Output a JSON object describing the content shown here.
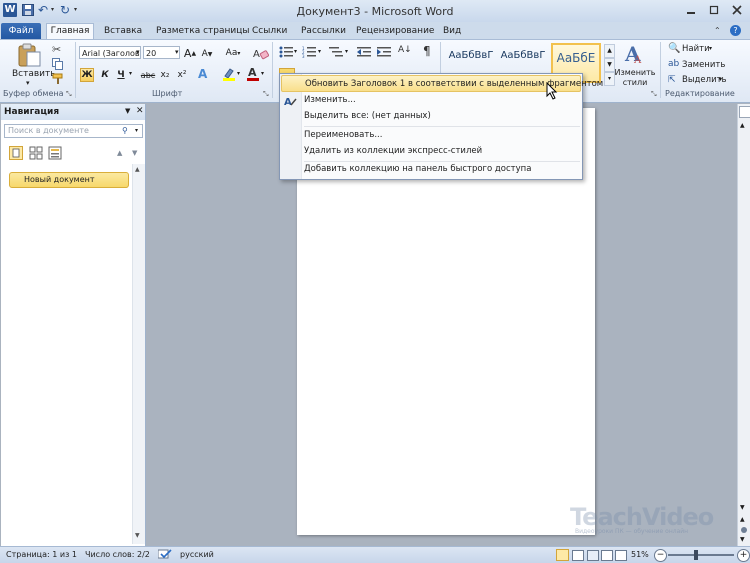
{
  "window": {
    "title": "Документ3  -  Microsoft Word"
  },
  "tabs": [
    {
      "label": "Файл"
    },
    {
      "label": "Главная"
    },
    {
      "label": "Вставка"
    },
    {
      "label": "Разметка страницы"
    },
    {
      "label": "Ссылки"
    },
    {
      "label": "Рассылки"
    },
    {
      "label": "Рецензирование"
    },
    {
      "label": "Вид"
    }
  ],
  "clipboard": {
    "paste_label": "Вставить",
    "group_label": "Буфер обмена"
  },
  "font": {
    "name": "Arial (Заголов",
    "size": "20",
    "group_label": "Шрифт",
    "bold": "Ж",
    "italic": "К",
    "underline": "Ч",
    "grow": "A",
    "shrink": "A",
    "case": "Aa",
    "strike": "abc",
    "sub": "x₂",
    "sup": "x²"
  },
  "styles": {
    "thumbnails": [
      "АаБбВвГ",
      "АаБбВвГ",
      "АаБбЕ"
    ],
    "change_label": "Изменить стили"
  },
  "editing": {
    "find": "Найти",
    "replace": "Заменить",
    "select": "Выделить",
    "group_label": "Редактирование"
  },
  "context_menu": {
    "items": [
      "Обновить Заголовок 1 в соответствии с выделенным фрагментом",
      "Изменить...",
      "Выделить все: (нет данных)",
      "Переименовать...",
      "Удалить из коллекции экспресс-стилей",
      "Добавить коллекцию на панель быстрого доступа"
    ]
  },
  "navigation": {
    "title": "Навигация",
    "search_placeholder": "Поиск в документе",
    "items": [
      "Новый документ"
    ]
  },
  "status": {
    "page": "Страница: 1 из 1",
    "words": "Число слов: 2/2",
    "language": "русский",
    "zoom": "51%"
  },
  "watermark": {
    "text": "TeachVideo",
    "subtitle": "Видеоуроки ПК — обучение онлайн"
  },
  "colors": {
    "accent": "#2b5797",
    "highlight": "#f9df8b",
    "font_color": "#c00000",
    "marker": "#ffff00"
  }
}
